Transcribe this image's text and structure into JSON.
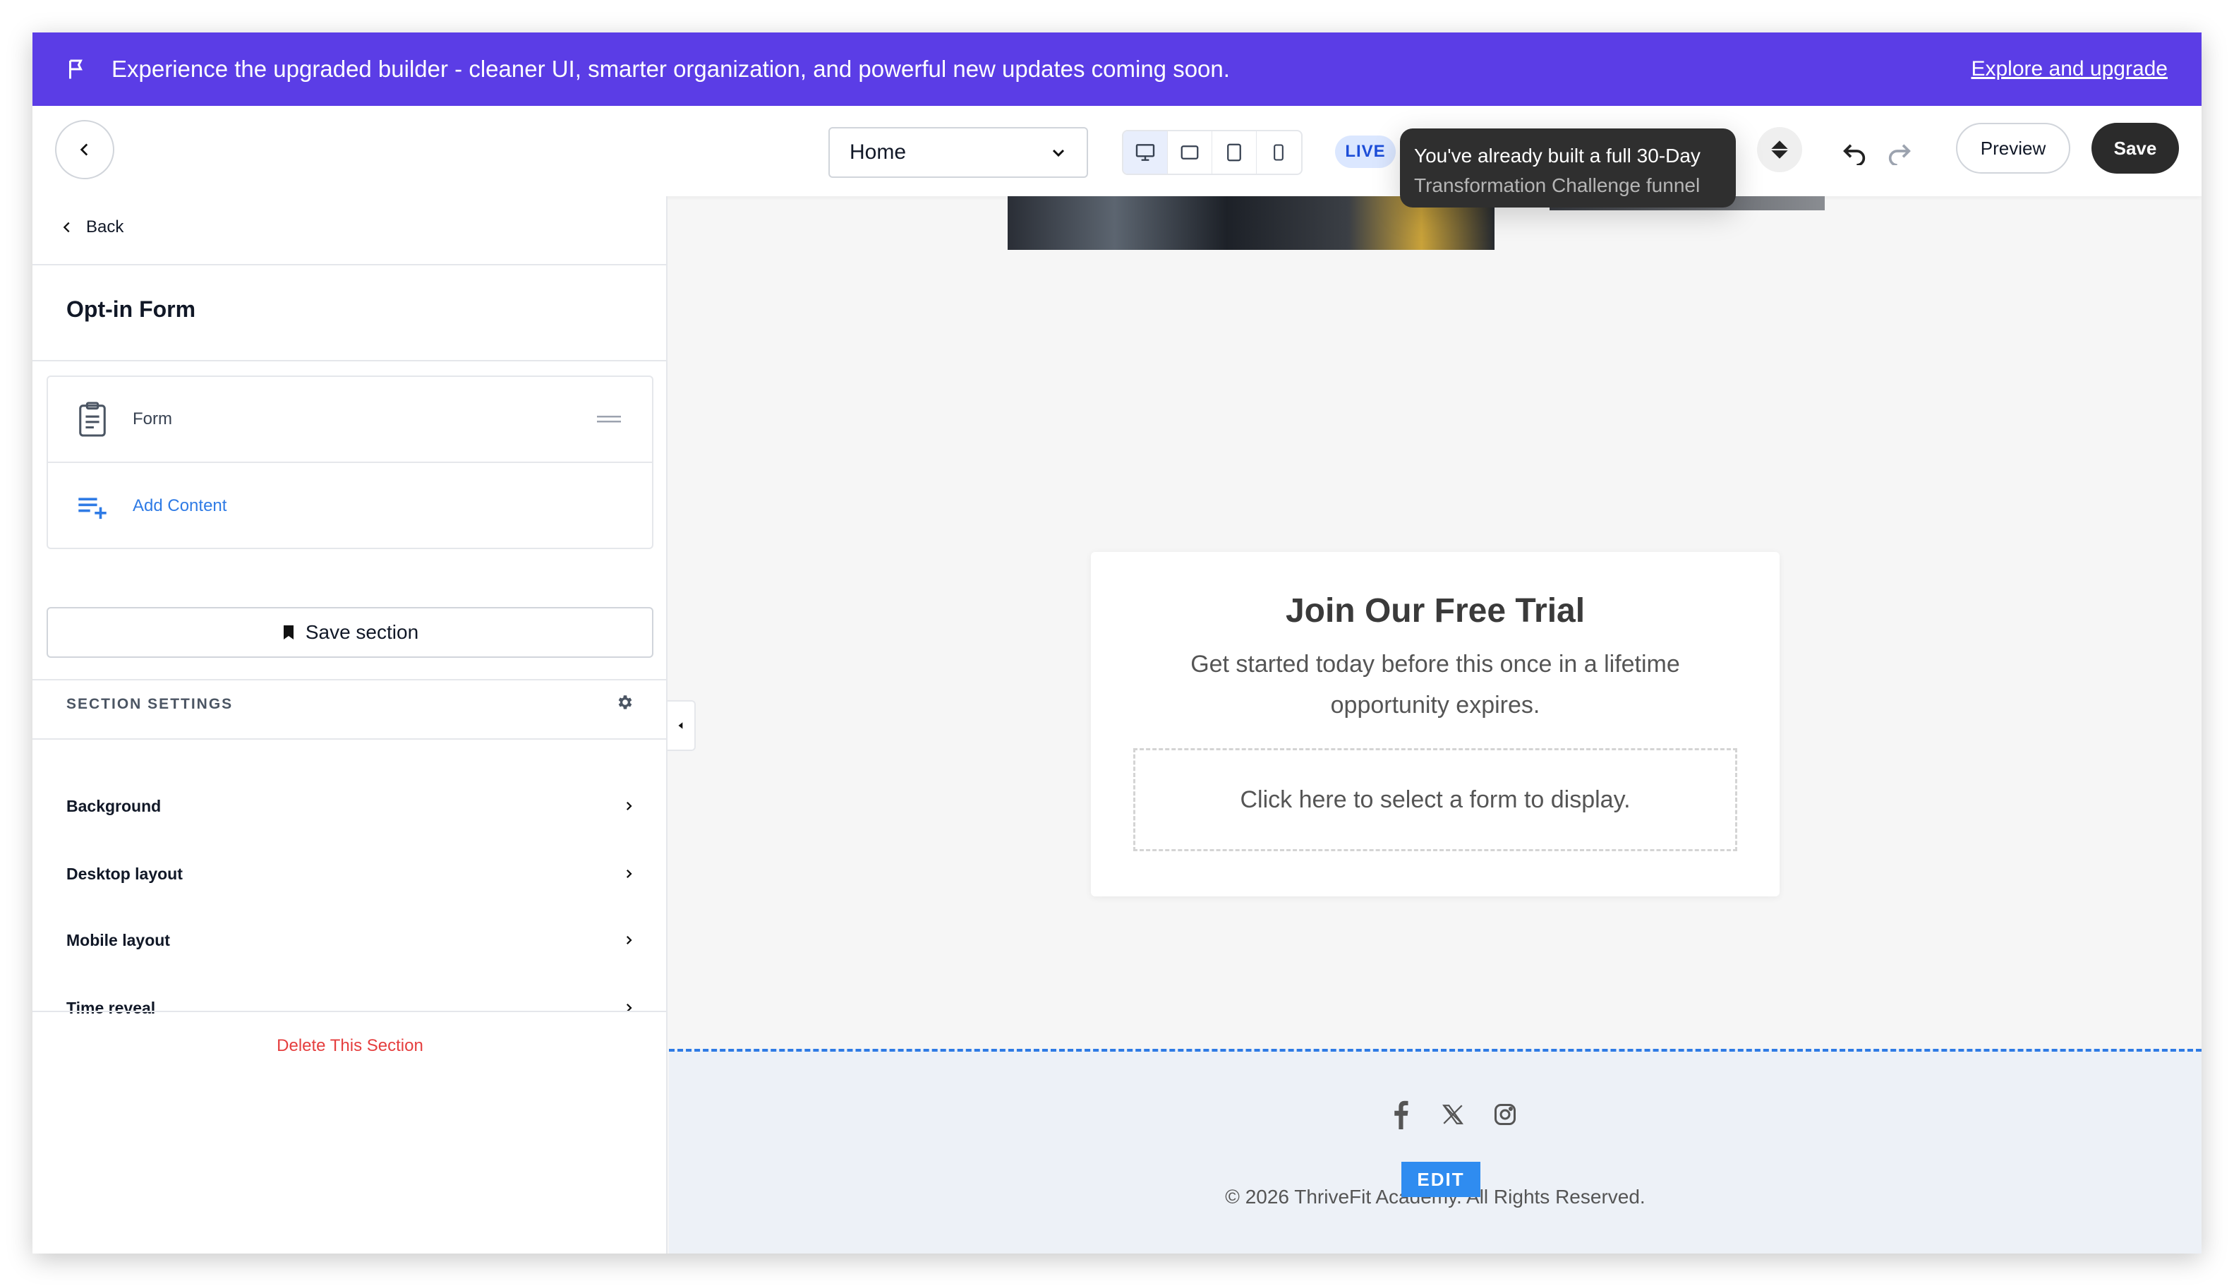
{
  "banner": {
    "message": "Experience the upgraded builder - cleaner UI, smarter organization, and powerful new updates coming soon.",
    "link_label": "Explore and upgrade",
    "background_color": "#5b3de6"
  },
  "toolbar": {
    "page_select_value": "Home",
    "live_label": "LIVE",
    "tooltip_line1": "You've already built a full 30-Day",
    "tooltip_line2": "Transformation Challenge funnel",
    "preview_label": "Preview",
    "save_label": "Save",
    "devices": [
      "desktop-icon",
      "tablet-landscape-icon",
      "tablet-portrait-icon",
      "mobile-icon"
    ],
    "active_device": "desktop-icon"
  },
  "panel": {
    "back_label": "Back",
    "title": "Opt-in Form",
    "elements": [
      {
        "label": "Form",
        "icon": "clipboard-icon"
      },
      {
        "label": "Add Content",
        "icon": "add-list-icon"
      }
    ],
    "save_section_label": "Save section",
    "section_settings_label": "SECTION SETTINGS",
    "settings": [
      {
        "label": "Background"
      },
      {
        "label": "Desktop layout"
      },
      {
        "label": "Mobile layout"
      },
      {
        "label": "Time reveal"
      }
    ],
    "delete_label": "Delete This Section"
  },
  "canvas": {
    "form_title": "Join Our Free Trial",
    "form_subtitle": "Get started today before this once in a lifetime opportunity expires.",
    "form_placeholder": "Click here to select a form to display.",
    "footer": {
      "social_icons": [
        "facebook-icon",
        "x-icon",
        "instagram-icon"
      ],
      "edit_label": "EDIT",
      "copyright": "© 2026 ThriveFit Academy. All Rights Reserved."
    }
  },
  "colors": {
    "accent_blue": "#2f7be5",
    "danger": "#e53e3e",
    "dark_button": "#2b2b2b"
  }
}
